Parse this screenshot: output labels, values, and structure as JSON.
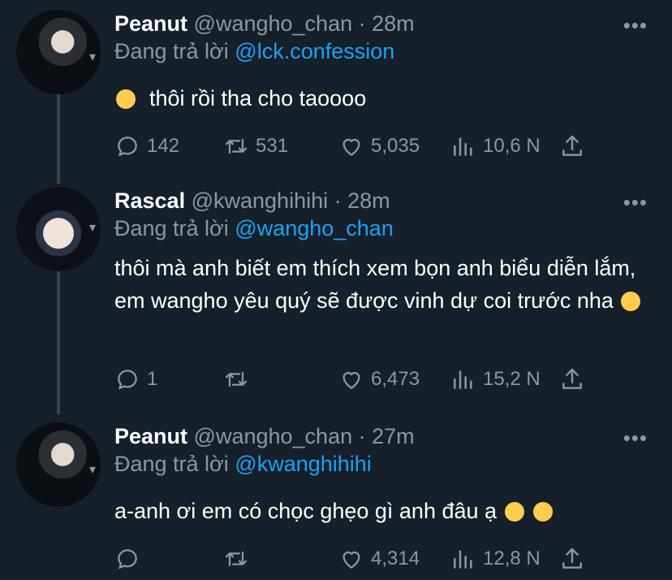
{
  "tweets": [
    {
      "name": "Peanut",
      "handle": "@wangho_chan",
      "time": "28m",
      "replying_label": "Đang trả lời",
      "replying_to": "@lck.confession",
      "text": "thôi rồi tha cho taoooo",
      "emoji_lead": "slightly-smiling-face",
      "emoji_tail": "",
      "replies": "142",
      "retweets": "531",
      "likes": "5,035",
      "views": "10,6 N"
    },
    {
      "name": "Rascal",
      "handle": "@kwanghihihi",
      "time": "28m",
      "replying_label": "Đang trả lời",
      "replying_to": "@wangho_chan",
      "text": "thôi mà anh biết em thích xem bọn anh biểu diễn lắm, em wangho yêu quý sẽ được vinh dự coi trước nha",
      "emoji_lead": "",
      "emoji_tail": "face-blowing-a-kiss",
      "replies": "1",
      "retweets": "",
      "likes": "6,473",
      "views": "15,2 N"
    },
    {
      "name": "Peanut",
      "handle": "@wangho_chan",
      "time": "27m",
      "replying_label": "Đang trả lời",
      "replying_to": "@kwanghihihi",
      "text": "a-anh ơi em có chọc ghẹo gì anh đâu ạ",
      "emoji_lead": "",
      "emoji_tail": "loudly-crying-face x2",
      "replies": "",
      "retweets": "",
      "likes": "4,314",
      "views": "12,8 N"
    }
  ],
  "colors": {
    "background": "#15202b",
    "text": "#ffffff",
    "muted": "#8899a6",
    "link": "#1da1f2",
    "emoji": "#ffcc4d"
  },
  "separator": "·",
  "more_glyph": "•••"
}
